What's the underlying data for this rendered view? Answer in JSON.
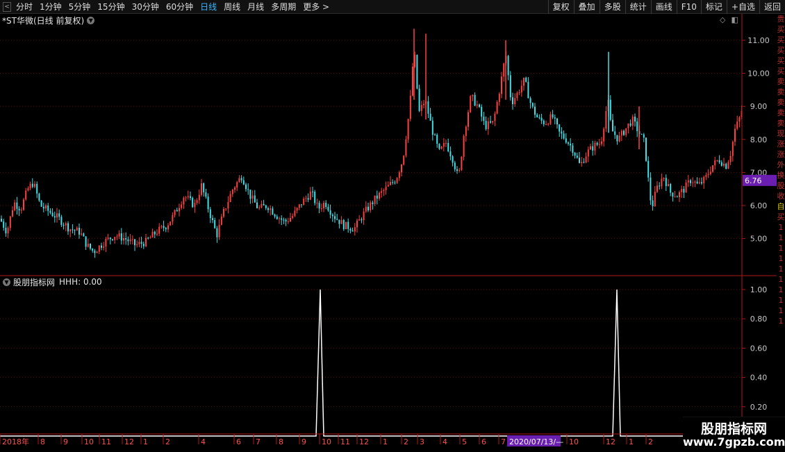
{
  "toolbar": {
    "nav_arrow": "<",
    "periods": [
      "分时",
      "1分钟",
      "5分钟",
      "15分钟",
      "30分钟",
      "60分钟",
      "日线",
      "周线",
      "月线",
      "多周期",
      "更多 >"
    ],
    "active_period": "日线",
    "right_buttons": [
      "复权",
      "叠加",
      "多股",
      "统计",
      "画线",
      "F10",
      "标记",
      "+自选",
      "返回"
    ]
  },
  "main_chart": {
    "title": "*ST华微(日线 前复权)",
    "current_price_label": "6.76",
    "up_color": "#ff4040",
    "down_color": "#40e0e8",
    "accent_purple": "#6a1fb0"
  },
  "indicator": {
    "name": "股朋指标网",
    "value_text": "HHH: 0.00"
  },
  "x_axis": {
    "date_tag": "2020/07/13/—"
  },
  "chart_data": [
    {
      "type": "candlestick",
      "title": "*ST华微(日线 前复权)",
      "yticks": [
        "11.00",
        "10.00",
        "9.00",
        "8.00",
        "7.00",
        "6.00",
        "5.00"
      ],
      "ylim": [
        4.0,
        11.6
      ],
      "x_tick_labels": [
        "2018年",
        "8",
        "9",
        "10",
        "11",
        "12",
        "1",
        "2",
        "4",
        "6",
        "7",
        "8",
        "9",
        "10",
        "11",
        "12",
        "1",
        "2",
        "3",
        "4",
        "5",
        "6",
        "7",
        "10",
        "12",
        "1",
        "2"
      ],
      "x_tick_positions": [
        0,
        55,
        88,
        118,
        143,
        176,
        203,
        235,
        286,
        337,
        365,
        398,
        431,
        460,
        487,
        514,
        548,
        578,
        601,
        634,
        662,
        690,
        718,
        816,
        869,
        902,
        930
      ],
      "current_price": 6.76,
      "close_series": [
        [
          0,
          5.6
        ],
        [
          10,
          5.2
        ],
        [
          20,
          6.1
        ],
        [
          30,
          5.9
        ],
        [
          40,
          6.5
        ],
        [
          48,
          6.7
        ],
        [
          58,
          6.0
        ],
        [
          72,
          5.8
        ],
        [
          85,
          5.6
        ],
        [
          100,
          5.3
        ],
        [
          115,
          5.2
        ],
        [
          125,
          4.8
        ],
        [
          135,
          4.6
        ],
        [
          150,
          4.9
        ],
        [
          165,
          5.1
        ],
        [
          180,
          5.0
        ],
        [
          195,
          4.8
        ],
        [
          210,
          4.9
        ],
        [
          225,
          5.2
        ],
        [
          240,
          5.4
        ],
        [
          250,
          5.7
        ],
        [
          265,
          6.3
        ],
        [
          280,
          6.0
        ],
        [
          290,
          6.6
        ],
        [
          300,
          5.9
        ],
        [
          312,
          5.1
        ],
        [
          322,
          5.8
        ],
        [
          335,
          6.5
        ],
        [
          348,
          6.9
        ],
        [
          360,
          6.3
        ],
        [
          372,
          5.9
        ],
        [
          385,
          6.0
        ],
        [
          398,
          5.7
        ],
        [
          410,
          5.5
        ],
        [
          422,
          5.7
        ],
        [
          435,
          6.1
        ],
        [
          448,
          6.4
        ],
        [
          458,
          5.9
        ],
        [
          468,
          6.1
        ],
        [
          480,
          5.7
        ],
        [
          495,
          5.4
        ],
        [
          510,
          5.3
        ],
        [
          525,
          5.8
        ],
        [
          540,
          6.2
        ],
        [
          555,
          6.5
        ],
        [
          570,
          6.8
        ],
        [
          580,
          7.4
        ],
        [
          590,
          9.0
        ],
        [
          596,
          10.8
        ],
        [
          603,
          8.8
        ],
        [
          612,
          9.2
        ],
        [
          622,
          8.3
        ],
        [
          632,
          7.6
        ],
        [
          642,
          7.9
        ],
        [
          652,
          7.4
        ],
        [
          660,
          6.8
        ],
        [
          668,
          8.2
        ],
        [
          678,
          9.3
        ],
        [
          688,
          9.0
        ],
        [
          698,
          8.4
        ],
        [
          710,
          8.5
        ],
        [
          720,
          9.6
        ],
        [
          728,
          10.6
        ],
        [
          736,
          9.1
        ],
        [
          745,
          9.4
        ],
        [
          755,
          9.8
        ],
        [
          765,
          9.0
        ],
        [
          775,
          8.6
        ],
        [
          785,
          8.5
        ],
        [
          795,
          8.7
        ],
        [
          805,
          8.2
        ],
        [
          815,
          8.0
        ],
        [
          825,
          7.7
        ],
        [
          835,
          7.2
        ],
        [
          845,
          7.6
        ],
        [
          855,
          7.8
        ],
        [
          865,
          7.9
        ],
        [
          875,
          9.2
        ],
        [
          880,
          8.3
        ],
        [
          890,
          8.0
        ],
        [
          900,
          8.3
        ],
        [
          910,
          8.6
        ],
        [
          920,
          8.2
        ],
        [
          928,
          7.9
        ],
        [
          932,
          7.0
        ],
        [
          938,
          5.9
        ],
        [
          945,
          6.5
        ],
        [
          955,
          6.9
        ],
        [
          965,
          6.4
        ],
        [
          975,
          6.3
        ],
        [
          985,
          6.5
        ],
        [
          995,
          6.8
        ],
        [
          1005,
          6.6
        ],
        [
          1015,
          6.8
        ],
        [
          1025,
          7.2
        ],
        [
          1035,
          7.4
        ],
        [
          1045,
          7.2
        ],
        [
          1052,
          7.6
        ],
        [
          1058,
          8.3
        ],
        [
          1064,
          8.6
        ],
        [
          1068,
          8.9
        ]
      ],
      "spikes": [
        [
          596,
          11.35,
          9.2
        ],
        [
          613,
          11.2,
          8.6
        ],
        [
          728,
          11.0,
          9.2
        ],
        [
          876,
          10.65,
          8.2
        ],
        [
          920,
          9.0,
          7.7
        ]
      ]
    },
    {
      "type": "line",
      "series": [
        {
          "name": "HHH",
          "values": [
            0,
            1.0,
            0,
            0,
            1.0,
            0
          ]
        }
      ],
      "x": [
        455,
        461,
        466,
        882,
        888,
        893
      ],
      "yticks": [
        "1.00",
        "0.80",
        "0.60",
        "0.40",
        "0.20"
      ],
      "ylim": [
        0,
        1.0
      ]
    }
  ]
}
